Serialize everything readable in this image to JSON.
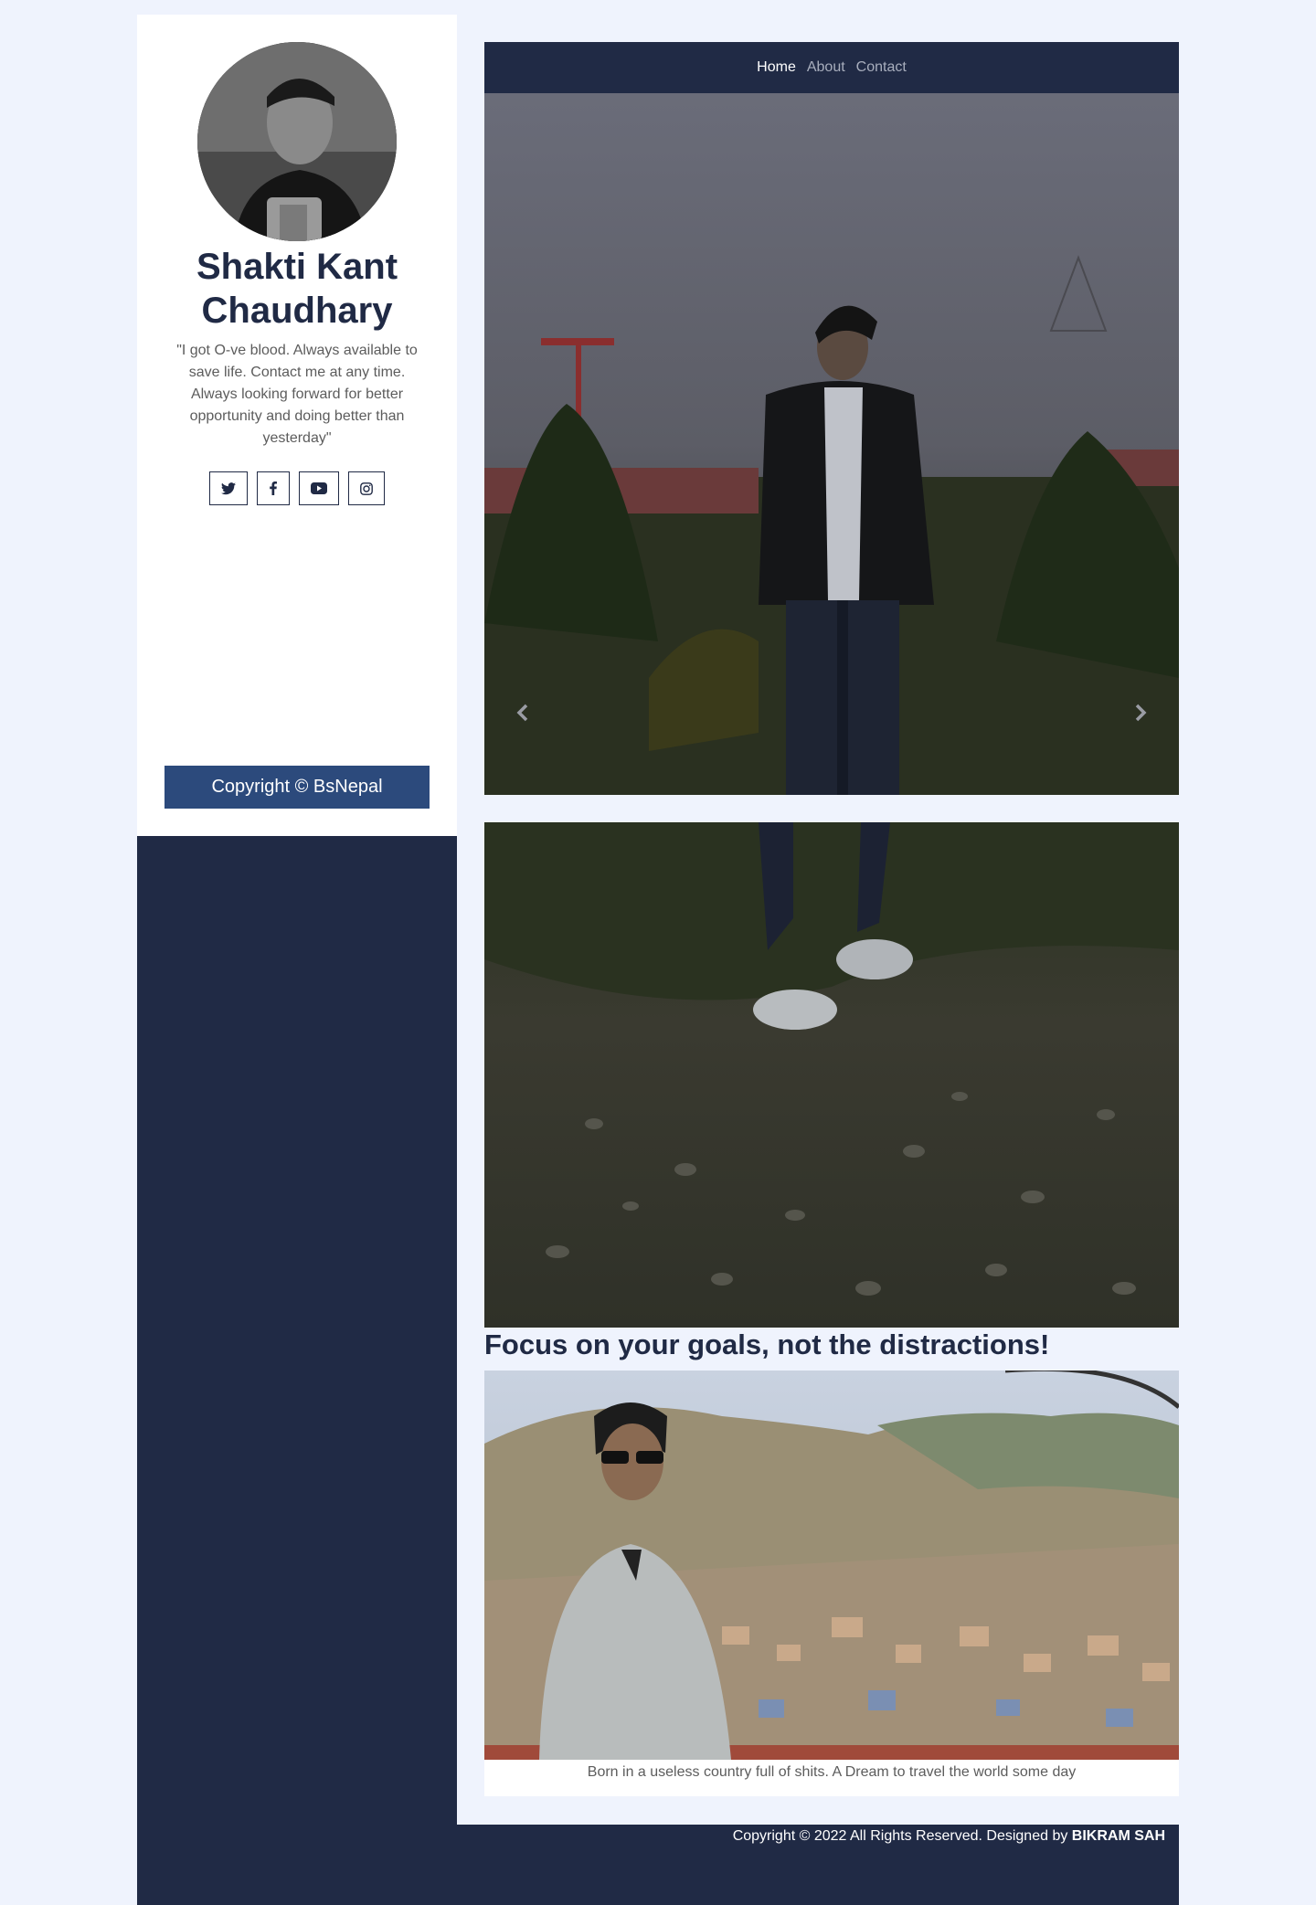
{
  "profile": {
    "name_line1": "Shakti Kant",
    "name_line2": "Chaudhary",
    "quote": "\"I got O-ve blood. Always available to save life. Contact me at any time. Always looking forward for better opportunity and doing better than yesterday\"",
    "socials": [
      "twitter-icon",
      "facebook-icon",
      "youtube-icon",
      "instagram-icon"
    ],
    "copyright": "Copyright © BsNepal"
  },
  "nav": {
    "items": [
      "Home",
      "About",
      "Contact"
    ],
    "active": "Home"
  },
  "carousel": {
    "prev_icon": "chevron-left-icon",
    "next_icon": "chevron-right-icon"
  },
  "main": {
    "focus_title": "Focus on your goals, not the distractions!",
    "photo_caption": "Born in a useless country full of shits. A Dream to travel the world some day"
  },
  "footer": {
    "text": "Copyright © 2022 All Rights Reserved. Designed by ",
    "designer": "BIKRAM SAH"
  },
  "colors": {
    "navy": "#202a45",
    "accent_blue": "#2c4a7c",
    "page_bg": "#eff3fd"
  }
}
